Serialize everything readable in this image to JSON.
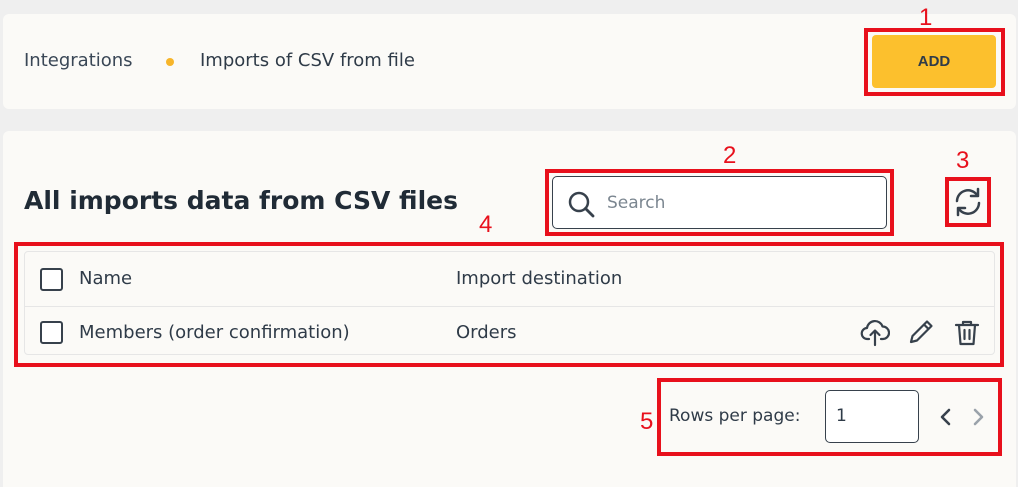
{
  "breadcrumb": {
    "items": [
      "Integrations",
      "Imports of CSV from file"
    ]
  },
  "header": {
    "add_label": "ADD"
  },
  "main": {
    "title": "All imports data from CSV files",
    "search": {
      "placeholder": "Search",
      "value": ""
    },
    "table": {
      "columns": [
        "Name",
        "Import destination"
      ],
      "rows": [
        {
          "name": "Members (order confirmation)",
          "destination": "Orders"
        }
      ]
    },
    "pagination": {
      "rows_per_page_label": "Rows per page:",
      "rows_per_page_value": "1"
    }
  },
  "annotations": [
    "1",
    "2",
    "3",
    "4",
    "5"
  ],
  "colors": {
    "accent": "#fcc02d",
    "annotation": "#e8101c",
    "text": "#2f3b48",
    "bullet": "#f7b52a"
  },
  "icons": [
    "search-icon",
    "refresh-icon",
    "upload-icon",
    "edit-icon",
    "delete-icon",
    "chevron-left-icon",
    "chevron-right-icon"
  ]
}
